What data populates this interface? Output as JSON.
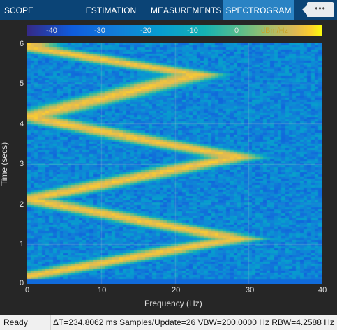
{
  "tabs": [
    {
      "label": "SCOPE",
      "active": false
    },
    {
      "label": "ESTIMATION",
      "active": false
    },
    {
      "label": "MEASUREMENTS",
      "active": false
    },
    {
      "label": "SPECTROGRAM",
      "active": true
    }
  ],
  "overflow_button": {
    "label": "•••",
    "icon": "more-options-icon"
  },
  "colorbar": {
    "ticks": [
      "-40",
      "-30",
      "-20",
      "-10",
      "0"
    ],
    "unit_label": "dBm/Hz",
    "colormap": "parula",
    "range": [
      -45,
      5
    ]
  },
  "chart_data": {
    "type": "heatmap",
    "xlabel": "Frequency (Hz)",
    "ylabel": "Time (secs)",
    "xlim": [
      0,
      40
    ],
    "ylim": [
      0,
      6
    ],
    "x_ticks": [
      "0",
      "10",
      "20",
      "30",
      "40"
    ],
    "y_ticks": [
      "0",
      "1",
      "2",
      "3",
      "4",
      "5",
      "6"
    ],
    "grid": true,
    "colormap": "parula",
    "clim_dbm_per_hz": [
      -45,
      5
    ],
    "background_level_dbm_per_hz": -28,
    "ridge": {
      "description_points": [
        [
          0,
          0.18
        ],
        [
          28.5,
          1.12
        ],
        [
          0,
          2.1
        ],
        [
          28.5,
          3.15
        ],
        [
          0,
          4.15
        ],
        [
          23,
          5.2
        ],
        [
          0,
          5.9
        ]
      ],
      "peak_dbm_per_hz": 2,
      "width_hz": 3
    }
  },
  "status": {
    "state": "Ready",
    "info": "ΔT=234.8062 ms  Samples/Update=26  VBW=200.0000 Hz  RBW=4.2588 Hz"
  }
}
